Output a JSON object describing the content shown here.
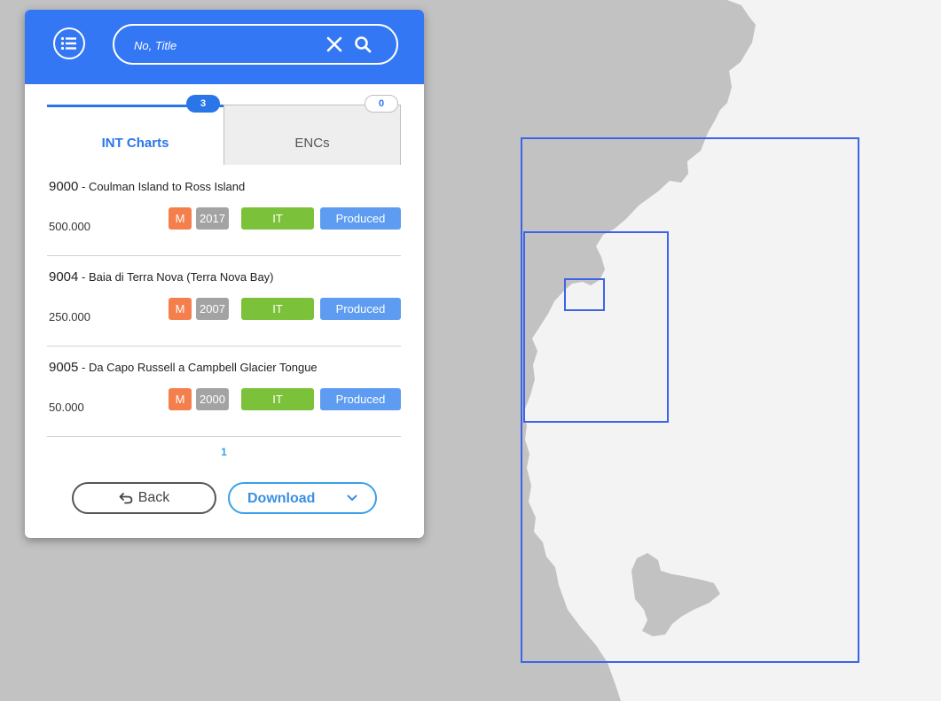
{
  "search": {
    "placeholder": "No, Title"
  },
  "tabs": [
    {
      "label": "INT Charts",
      "count": "3",
      "active": true
    },
    {
      "label": "ENCs",
      "count": "0",
      "active": false
    }
  ],
  "charts": [
    {
      "number": "9000",
      "title": "Coulman Island to Ross Island",
      "scale": "500.000",
      "m": "M",
      "year": "2017",
      "lang": "IT",
      "status": "Produced"
    },
    {
      "number": "9004",
      "title": "Baia di Terra Nova (Terra Nova Bay)",
      "scale": "250.000",
      "m": "M",
      "year": "2007",
      "lang": "IT",
      "status": "Produced"
    },
    {
      "number": "9005",
      "title": "Da Capo Russell a Campbell Glacier Tongue",
      "scale": "50.000",
      "m": "M",
      "year": "2000",
      "lang": "IT",
      "status": "Produced"
    }
  ],
  "pagination": {
    "current_page": "1"
  },
  "buttons": {
    "back": "Back",
    "download": "Download"
  },
  "colors": {
    "header": "#3477f5",
    "accent": "#2a76e8",
    "tag_m": "#f47f4c",
    "tag_year": "#a3a3a3",
    "tag_lang": "#7cc13a",
    "tag_status": "#5d9cf0",
    "land": "#c2c2c2",
    "sea": "#f3f3f3",
    "chart_outline": "#3d64e8"
  },
  "icons": {
    "menu": "list-icon",
    "clear": "close-icon",
    "search": "search-icon",
    "back": "undo-arrow-icon",
    "download_toggle": "chevron-down-icon"
  }
}
